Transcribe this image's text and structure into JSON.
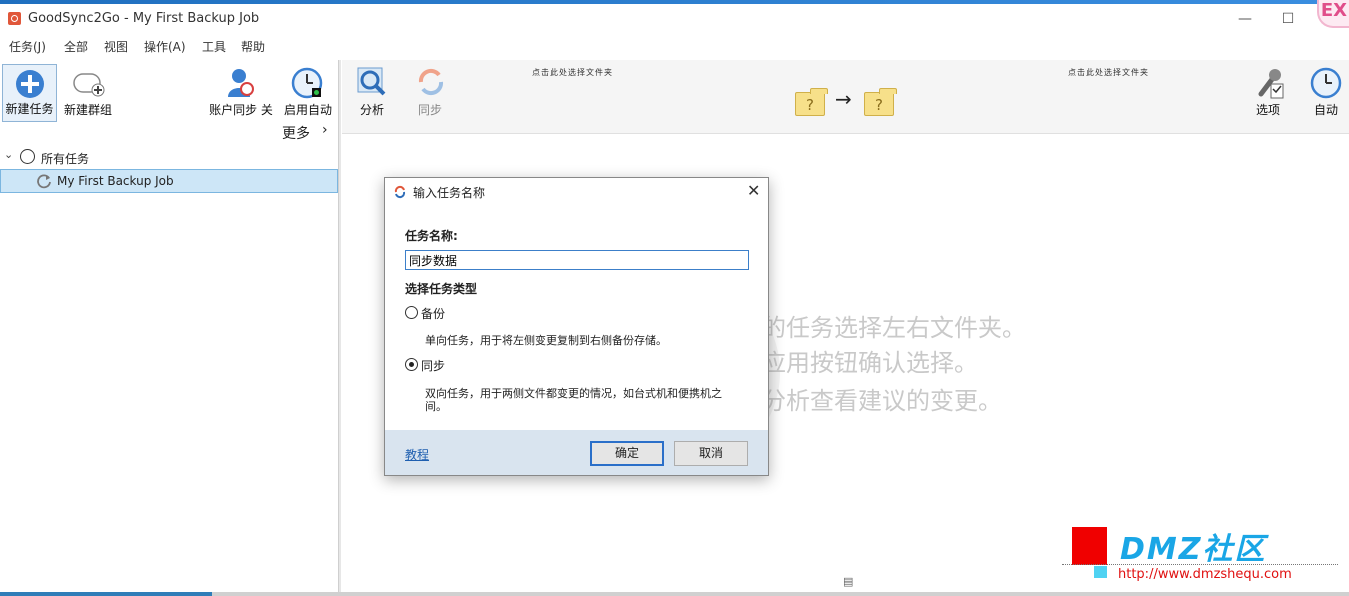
{
  "window": {
    "title": "GoodSync2Go - My First Backup Job",
    "badge": "EX"
  },
  "menu": [
    "任务(J)",
    "全部",
    "视图",
    "操作(A)",
    "工具",
    "帮助"
  ],
  "left_toolbar": {
    "new_job": "新建任务",
    "new_group": "新建群组",
    "account_sync": "账户同步 关",
    "auto_start": "启用自动",
    "more": "更多"
  },
  "tree": {
    "all_jobs": "所有任务",
    "job": "My First Backup Job"
  },
  "right_toolbar": {
    "analyze": "分析",
    "sync": "同步",
    "left_folder_hint": "点击此处选择文件夹",
    "right_folder_hint": "点击此处选择文件夹",
    "options": "选项",
    "auto": "自动"
  },
  "background_hint": [
    "的任务选择左右文件夹。",
    "应用按钮确认选择。",
    "分析查看建议的变更。"
  ],
  "dialog": {
    "title": "输入任务名称",
    "name_label": "任务名称:",
    "name_value": "同步数据",
    "type_label": "选择任务类型",
    "backup_label": "备份",
    "backup_desc": "单向任务，用于将左侧变更复制到右侧备份存储。",
    "sync_label": "同步",
    "sync_desc_1": "双向任务，用于两侧文件都变更的情况，如台式机和便携机之",
    "sync_desc_2": "间。",
    "selected_type": "同步",
    "tutorial": "教程",
    "ok": "确定",
    "cancel": "取消"
  },
  "watermark": {
    "brand": "DMZ社区",
    "url": "http://www.dmzshequ.com"
  },
  "colors": {
    "accent": "#2a6fc9",
    "selection": "#cde6f7",
    "footer": "#d9e4ef"
  }
}
